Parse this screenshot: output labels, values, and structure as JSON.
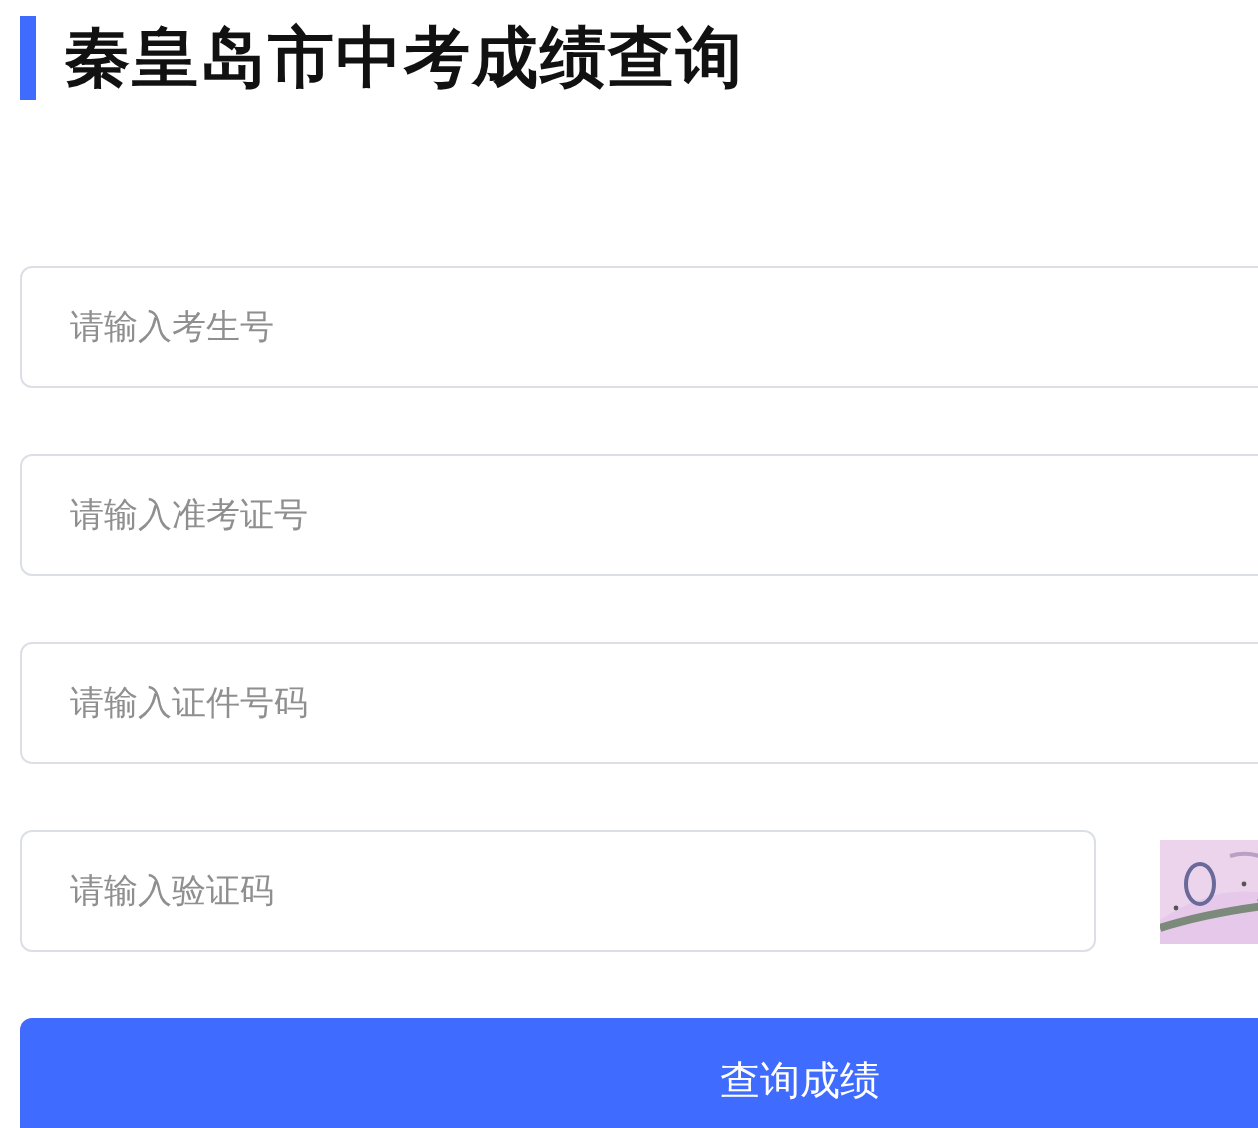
{
  "title": "秦皇岛市中考成绩查询",
  "fields": [
    {
      "kind": "text",
      "placeholder": "请输入考生号"
    },
    {
      "kind": "text",
      "placeholder": "请输入准考证号"
    },
    {
      "kind": "text",
      "placeholder": "请输入证件号码"
    },
    {
      "kind": "captcha",
      "placeholder": "请输入验证码"
    }
  ],
  "submit_button": "查询成绩"
}
